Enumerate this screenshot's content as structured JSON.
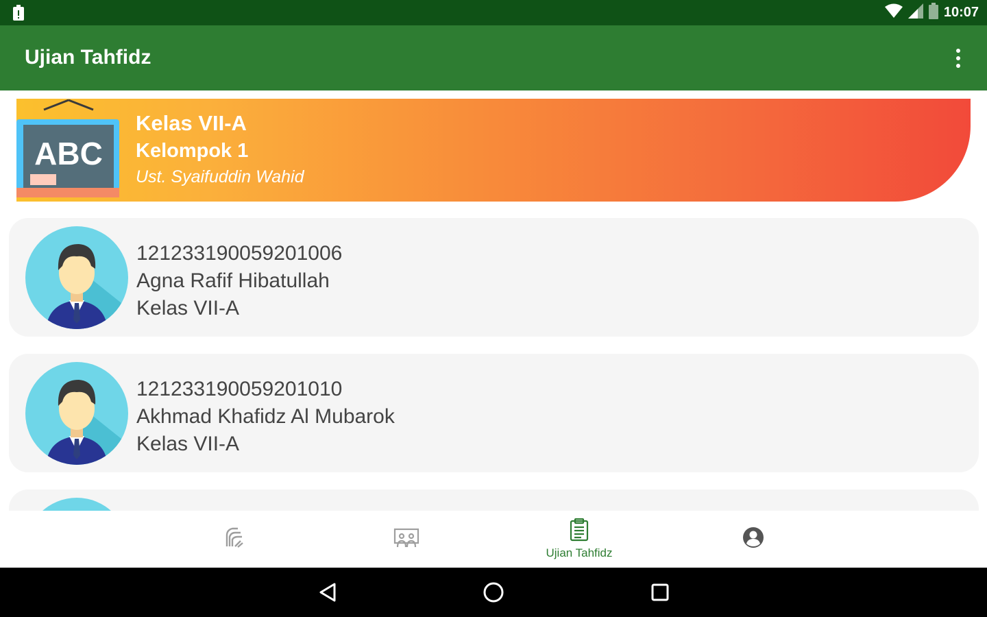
{
  "status_bar": {
    "time": "10:07"
  },
  "app_bar": {
    "title": "Ujian Tahfidz",
    "menu_icon": "more-vert-icon"
  },
  "banner": {
    "board_text": "ABC",
    "class_name": "Kelas VII-A",
    "group_name": "Kelompok 1",
    "teacher": "Ust. Syaifuddin Wahid"
  },
  "students": [
    {
      "nis": "121233190059201006",
      "name": "Agna Rafif Hibatullah",
      "class": "Kelas VII-A"
    },
    {
      "nis": "121233190059201010",
      "name": "Akhmad Khafidz Al Mubarok",
      "class": "Kelas VII-A"
    }
  ],
  "bottom_nav": {
    "items": [
      {
        "icon": "hands-icon",
        "label": ""
      },
      {
        "icon": "presentation-icon",
        "label": ""
      },
      {
        "icon": "clipboard-icon",
        "label": "Ujian Tahfidz",
        "active": true
      },
      {
        "icon": "account-circle-icon",
        "label": ""
      }
    ]
  },
  "colors": {
    "status_bar": "#0f5216",
    "app_bar": "#2e7d32",
    "accent": "#2e7d32",
    "banner_start": "#fbc02d",
    "banner_end": "#f24a3a",
    "card_bg": "#f5f5f5"
  }
}
